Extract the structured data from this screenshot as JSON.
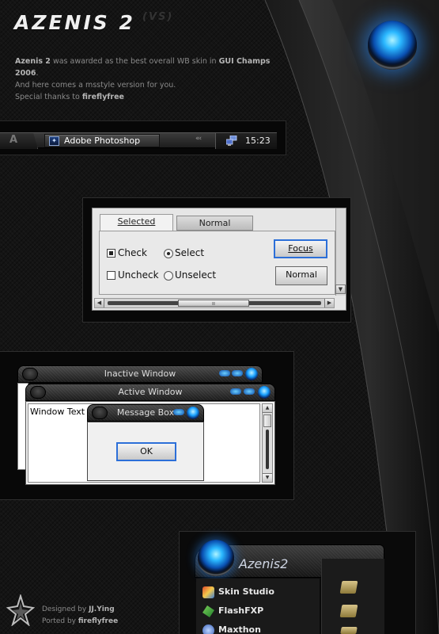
{
  "header": {
    "title": "AZENIS 2",
    "title_tag": "(VS)",
    "intro_line1_app": "Azenis 2",
    "intro_line1_mid": " was awarded as the best overall WB skin in ",
    "intro_line1_award": "GUI Champs 2006",
    "intro_line1_end": ".",
    "intro_line2": "And here comes a msstyle version for you.",
    "intro_line3_lead": "Special thanks to ",
    "intro_line3_name": "fireflyfree"
  },
  "taskbar": {
    "start_glyph": "A",
    "task_label": "Adobe Photoshop",
    "task_icon": "photoshop-icon",
    "chevrons": "«‹",
    "tray_icon": "network-icon",
    "clock": "15:23"
  },
  "widgets": {
    "tab_selected": "Selected",
    "tab_normal": "Normal",
    "check_checked": "Check",
    "check_unchecked": "Uncheck",
    "radio_selected": "Select",
    "radio_unselected": "Unselect",
    "button_focus": "Focus",
    "button_normal": "Normal",
    "scroll_grip": "ıı"
  },
  "windows": {
    "inactive_title": "Inactive Window",
    "active_title": "Active Window",
    "window_text": "Window Text",
    "message_title": "Message Box",
    "ok_label": "OK"
  },
  "launcher": {
    "title": "Azenis2",
    "items": [
      {
        "label": "Skin Studio",
        "icon": "skin-studio-icon"
      },
      {
        "label": "FlashFXP",
        "icon": "flashfxp-icon"
      },
      {
        "label": "Maxthon",
        "icon": "maxthon-icon"
      }
    ]
  },
  "footer": {
    "designed_lead": "Designed by ",
    "designed_name": "JJ.Ying",
    "ported_lead": "Ported by ",
    "ported_name": "fireflyfree"
  },
  "colors": {
    "background": "#141414",
    "accent_blue": "#2c6fd8",
    "orb_glow": "#18a0ff"
  }
}
